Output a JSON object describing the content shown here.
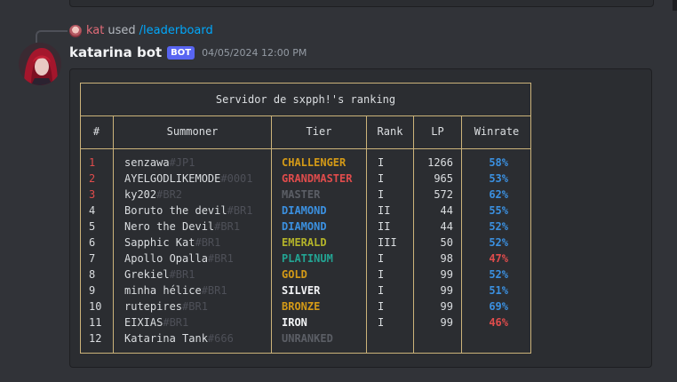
{
  "reply": {
    "user": "kat",
    "used": "used",
    "command": "/leaderboard"
  },
  "message": {
    "author": "katarina bot",
    "bot_tag": "BOT",
    "timestamp": "04/05/2024 12:00 PM"
  },
  "leaderboard": {
    "title": "Servidor de sxpph!'s ranking",
    "headers": {
      "num": "#",
      "summoner": "Summoner",
      "tier": "Tier",
      "rank": "Rank",
      "lp": "LP",
      "winrate": "Winrate"
    },
    "rows": [
      {
        "num": "1",
        "name": "senzawa",
        "tag": "#JP1",
        "tier": "CHALLENGER",
        "tier_style": "challenger",
        "rank": "I",
        "lp": "1266",
        "winrate": "58%",
        "wr_style": "good"
      },
      {
        "num": "2",
        "name": "AYELGODLIKEMODE",
        "tag": "#0001",
        "tier": "GRANDMASTER",
        "tier_style": "grandmaster",
        "rank": "I",
        "lp": "965",
        "winrate": "53%",
        "wr_style": "good"
      },
      {
        "num": "3",
        "name": "ky202",
        "tag": "#BR2",
        "tier": "MASTER",
        "tier_style": "master",
        "rank": "I",
        "lp": "572",
        "winrate": "62%",
        "wr_style": "good"
      },
      {
        "num": "4",
        "name": "Boruto the devil",
        "tag": "#BR1",
        "tier": "DIAMOND",
        "tier_style": "diamond",
        "rank": "II",
        "lp": "44",
        "winrate": "55%",
        "wr_style": "good"
      },
      {
        "num": "5",
        "name": "Nero the Devil",
        "tag": "#BR1",
        "tier": "DIAMOND",
        "tier_style": "diamond",
        "rank": "II",
        "lp": "44",
        "winrate": "52%",
        "wr_style": "good"
      },
      {
        "num": "6",
        "name": "Sapphic Kat",
        "tag": "#BR1",
        "tier": "EMERALD",
        "tier_style": "emerald",
        "rank": "III",
        "lp": "50",
        "winrate": "52%",
        "wr_style": "good"
      },
      {
        "num": "7",
        "name": "Apollo Opalla",
        "tag": "#BR1",
        "tier": "PLATINUM",
        "tier_style": "platinum",
        "rank": "I",
        "lp": "98",
        "winrate": "47%",
        "wr_style": "bad"
      },
      {
        "num": "8",
        "name": "Grekiel",
        "tag": "#BR1",
        "tier": "GOLD",
        "tier_style": "gold",
        "rank": "I",
        "lp": "99",
        "winrate": "52%",
        "wr_style": "good"
      },
      {
        "num": "9",
        "name": "minha hélice",
        "tag": "#BR1",
        "tier": "SILVER",
        "tier_style": "silver",
        "rank": "I",
        "lp": "99",
        "winrate": "51%",
        "wr_style": "good"
      },
      {
        "num": "10",
        "name": "rutepires",
        "tag": "#BR1",
        "tier": "BRONZE",
        "tier_style": "bronze",
        "rank": "I",
        "lp": "99",
        "winrate": "69%",
        "wr_style": "good"
      },
      {
        "num": "11",
        "name": "EIXIAS",
        "tag": "#BR1",
        "tier": "IRON",
        "tier_style": "iron",
        "rank": "I",
        "lp": "99",
        "winrate": "46%",
        "wr_style": "bad"
      },
      {
        "num": "12",
        "name": "Katarina Tank",
        "tag": "#666",
        "tier": "UNRANKED",
        "tier_style": "unranked",
        "rank": "",
        "lp": "",
        "winrate": "",
        "wr_style": "good"
      }
    ]
  }
}
